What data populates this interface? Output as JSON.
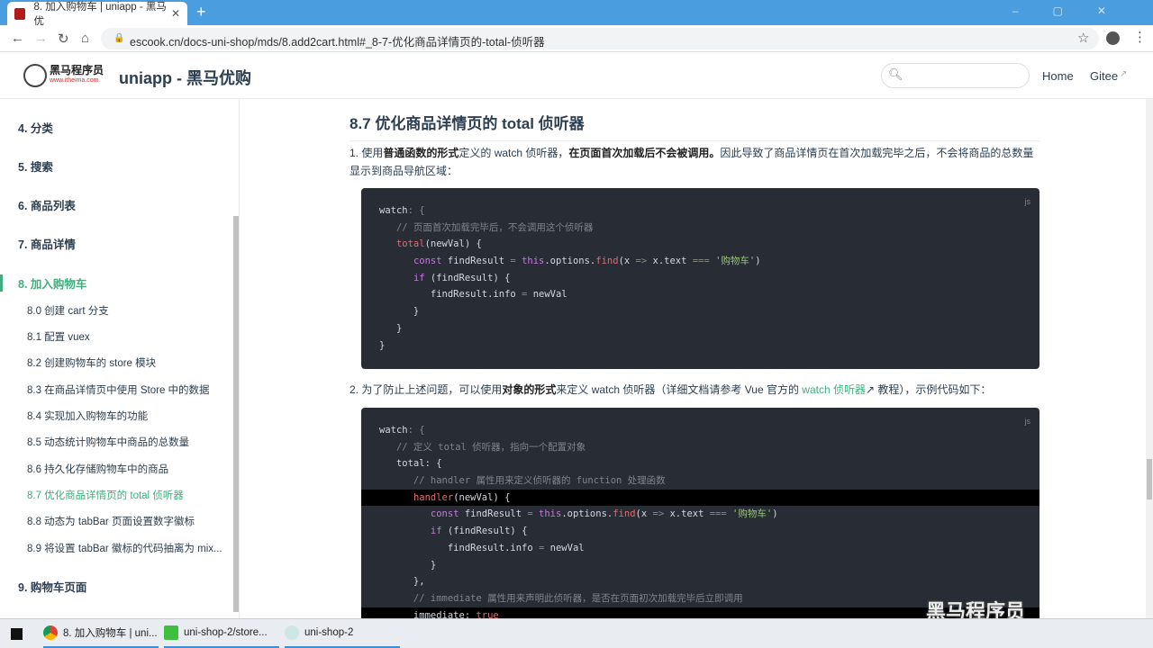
{
  "browser": {
    "tab_title": "8. 加入购物车 | uniapp - 黑马优",
    "url": "escook.cn/docs-uni-shop/mds/8.add2cart.html#_8-7-优化商品详情页的-total-侦听器"
  },
  "site": {
    "logo_text": "黑马程序员",
    "logo_sub": "www.itheima.com",
    "title": "uniapp - 黑马优购",
    "nav": [
      "Home",
      "Gitee"
    ]
  },
  "sidebar": {
    "groups": [
      {
        "label": "4. 分类"
      },
      {
        "label": "5. 搜索"
      },
      {
        "label": "6. 商品列表"
      },
      {
        "label": "7. 商品详情"
      },
      {
        "label": "8. 加入购物车"
      }
    ],
    "subitems": [
      "8.0 创建 cart 分支",
      "8.1 配置 vuex",
      "8.2 创建购物车的 store 模块",
      "8.3 在商品详情页中使用 Store 中的数据",
      "8.4 实现加入购物车的功能",
      "8.5 动态统计购物车中商品的总数量",
      "8.6 持久化存储购物车中的商品",
      "8.7 优化商品详情页的 total 侦听器",
      "8.8 动态为 tabBar 页面设置数字徽标",
      "8.9 将设置 tabBar 徽标的代码抽离为 mix..."
    ],
    "last": "9. 购物车页面"
  },
  "content": {
    "heading": "8.7 优化商品详情页的 total 侦听器",
    "p1": [
      "1. 使用",
      "普通函数的形式",
      "定义的 watch 侦听器，",
      "在页面首次加载后不会被调用。",
      "因此导致了商品详情页在首次加载完毕之后，不会将商品的总数量显示到商品导航区域："
    ],
    "p2": [
      "2. 为了防止上述问题，可以使用",
      "对象的形式",
      "来定义 watch 侦听器（详细文档请参考 Vue 官方的 ",
      "watch 侦听器",
      "↗ 教程），示例代码如下："
    ],
    "lang": "js",
    "code1": [
      [
        [
          "watch",
          ""
        ],
        [
          ": {",
          "t-op"
        ]
      ],
      [
        [
          "   // 页面首次加载完毕后，不会调用这个侦听器",
          "t-cm"
        ]
      ],
      [
        [
          "   ",
          ""
        ],
        [
          "total",
          "t-fn"
        ],
        [
          "(newVal) {",
          ""
        ]
      ],
      [
        [
          "      ",
          ""
        ],
        [
          "const",
          "t-kw"
        ],
        [
          " findResult ",
          ""
        ],
        [
          "=",
          "t-op"
        ],
        [
          " ",
          ""
        ],
        [
          "this",
          "t-th"
        ],
        [
          ".options.",
          ""
        ],
        [
          "find",
          "t-fn"
        ],
        [
          "(x ",
          ""
        ],
        [
          "=>",
          "t-op"
        ],
        [
          " x.text ",
          ""
        ],
        [
          "===",
          "t-op"
        ],
        [
          " ",
          ""
        ],
        [
          "'购物车'",
          "t-st"
        ],
        [
          ")",
          ""
        ]
      ],
      [
        [
          "      ",
          ""
        ],
        [
          "if",
          "t-kw"
        ],
        [
          " (findResult) {",
          ""
        ]
      ],
      [
        [
          "         findResult.info ",
          ""
        ],
        [
          "=",
          "t-op"
        ],
        [
          " newVal",
          ""
        ]
      ],
      [
        [
          "      }",
          ""
        ]
      ],
      [
        [
          "   }",
          ""
        ]
      ],
      [
        [
          "}",
          ""
        ]
      ]
    ],
    "code2": [
      [
        [
          "watch",
          ""
        ],
        [
          ": {",
          "t-op"
        ]
      ],
      [
        [
          "   // 定义 total 侦听器，指向一个配置对象",
          "t-cm"
        ]
      ],
      [
        [
          "   total: {",
          ""
        ]
      ],
      [
        [
          "      // handler 属性用来定义侦听器的 function 处理函数",
          "t-cm"
        ]
      ],
      [
        [
          "      ",
          ""
        ],
        [
          "handler",
          "t-fn"
        ],
        [
          "(newVal) {",
          ""
        ]
      ],
      [
        [
          "         ",
          ""
        ],
        [
          "const",
          "t-kw"
        ],
        [
          " findResult ",
          ""
        ],
        [
          "=",
          "t-op"
        ],
        [
          " ",
          ""
        ],
        [
          "this",
          "t-th"
        ],
        [
          ".options.",
          ""
        ],
        [
          "find",
          "t-fn"
        ],
        [
          "(x ",
          ""
        ],
        [
          "=>",
          "t-op"
        ],
        [
          " x.text ",
          ""
        ],
        [
          "===",
          "t-op"
        ],
        [
          " ",
          ""
        ],
        [
          "'购物车'",
          "t-st"
        ],
        [
          ")",
          ""
        ]
      ],
      [
        [
          "         ",
          ""
        ],
        [
          "if",
          "t-kw"
        ],
        [
          " (findResult) {",
          ""
        ]
      ],
      [
        [
          "            findResult.info ",
          ""
        ],
        [
          "=",
          "t-op"
        ],
        [
          " newVal",
          ""
        ]
      ],
      [
        [
          "         }",
          ""
        ]
      ],
      [
        [
          "      },",
          ""
        ]
      ],
      [
        [
          "      // immediate 属性用来声明此侦听器，是否在页面初次加载完毕后立即调用",
          "t-cm"
        ]
      ],
      [
        [
          "      immediate: ",
          ""
        ],
        [
          "true",
          "t-bool"
        ]
      ]
    ]
  },
  "watermark": "黑马程序员",
  "taskbar": [
    "8. 加入购物车 | uni...",
    "uni-shop-2/store...",
    "uni-shop-2"
  ]
}
